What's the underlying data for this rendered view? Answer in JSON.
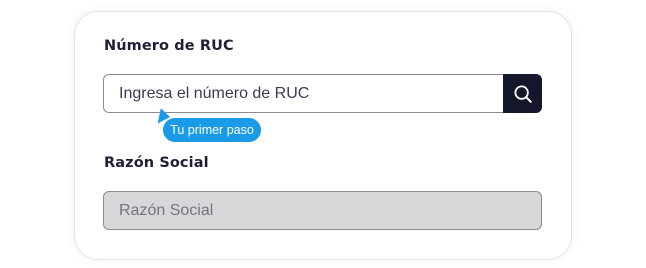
{
  "ruc": {
    "label": "Número de RUC",
    "placeholder": "Ingresa el número de RUC",
    "value": "",
    "search_icon": "search-icon"
  },
  "tooltip": {
    "text": "Tu primer paso"
  },
  "razon_social": {
    "label": "Razón Social",
    "placeholder": "Razón Social",
    "value": ""
  },
  "colors": {
    "accent_dark": "#15172b",
    "tooltip_blue": "#1a9be8",
    "label_text": "#1e2036",
    "disabled_bg": "#d7d7da"
  }
}
